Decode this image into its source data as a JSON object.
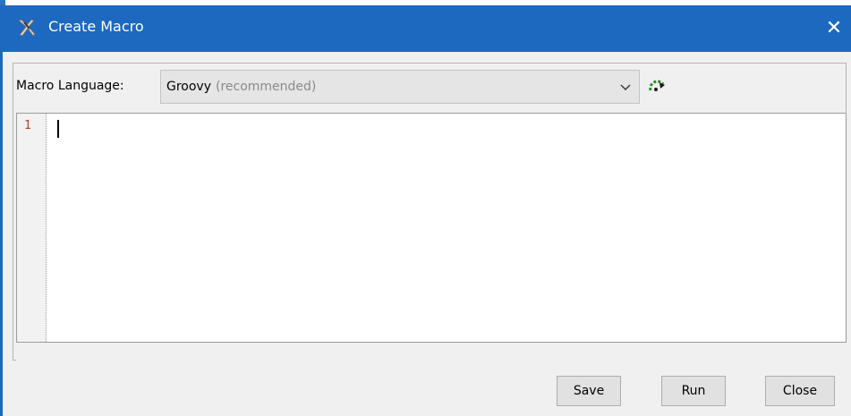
{
  "window": {
    "title": "Create Macro",
    "close_glyph": "✕",
    "app_icon": "tool-icon"
  },
  "macro_language": {
    "label": "Macro Language:",
    "selected_value": "Groovy",
    "selected_hint": "(recommended)",
    "dropdown_icon": "chevron-down-icon",
    "run_icon": "script-run-icon"
  },
  "editor": {
    "line_numbers": [
      "1"
    ]
  },
  "buttons": {
    "save": "Save",
    "run": "Run",
    "close": "Close"
  },
  "colors": {
    "titlebar": "#1c69bf",
    "line_number": "#c0392b",
    "hint_text": "#8a8a8a"
  }
}
